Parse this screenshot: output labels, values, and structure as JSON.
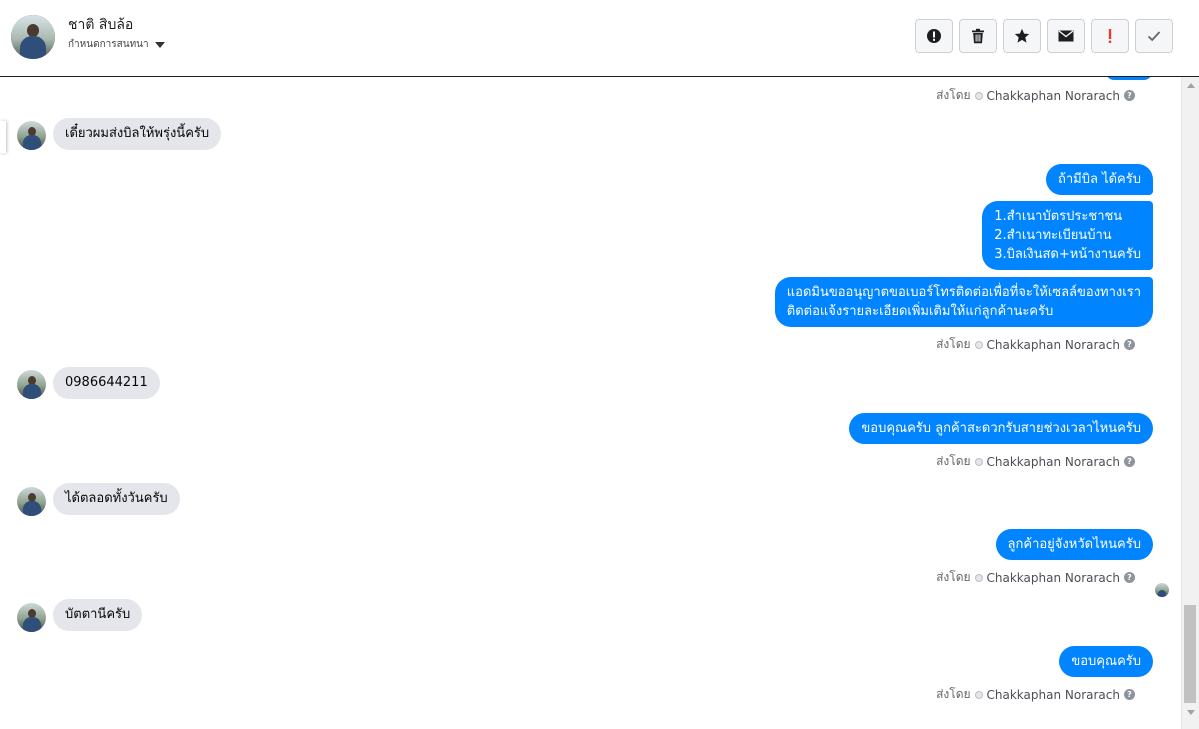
{
  "header": {
    "contact_name": "ชาติ สิบล้อ",
    "subtitle": "กำหนดการสนทนา",
    "toolbar": [
      {
        "icon": "alert-circle-icon",
        "name": "mark-spam-button"
      },
      {
        "icon": "trash-icon",
        "name": "delete-button"
      },
      {
        "icon": "star-icon",
        "name": "star-button"
      },
      {
        "icon": "mail-icon",
        "name": "mark-unread-button"
      },
      {
        "icon": "exclamation-icon",
        "name": "follow-up-button"
      },
      {
        "icon": "check-icon",
        "name": "mark-done-button"
      }
    ]
  },
  "sent_by": {
    "prefix": "ส่งโดย",
    "agent": "Chakkaphan Norarach",
    "help": "?"
  },
  "messages": {
    "in_1": "เดี๋ยวผมส่งบิลให้พรุ่งนี้ครับ",
    "out_1": "ถ้ามีบิล ได้ครับ",
    "out_2_line1": "1.สำเนาบัตรประชาชน",
    "out_2_line2": "2.สำเนาทะเบียนบ้าน",
    "out_2_line3": "3.บิลเงินสด+หน้างานครับ",
    "out_3_line1": "แอดมินขออนุญาตขอเบอร์โทรติดต่อเพื่อที่จะให้เซลล์ของทางเรา",
    "out_3_line2": "ติดต่อแจ้งรายละเอียดเพิ่มเติมให้แก่ลูกค้านะครับ",
    "in_2": "0986644211",
    "out_4": "ขอบคุณครับ ลูกค้าสะดวกรับสายช่วงเวลาไหนครับ",
    "in_3": "ได้ตลอดทั้งวันครับ",
    "out_5": "ลูกค้าอยู่จังหวัดไหนครับ",
    "in_4": "บัตตานีครับ",
    "out_6": "ขอบคุณครับ"
  },
  "colors": {
    "outgoing_bubble": "#0084ff",
    "incoming_bubble": "#e4e6eb"
  }
}
